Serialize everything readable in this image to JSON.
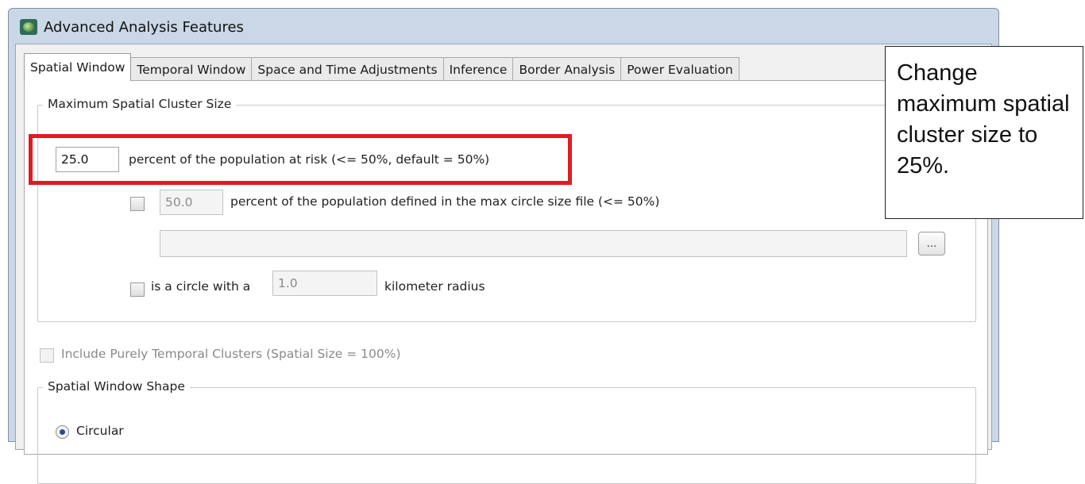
{
  "window": {
    "title": "Advanced Analysis Features"
  },
  "tabs": [
    {
      "label": "Spatial Window",
      "active": true
    },
    {
      "label": "Temporal Window",
      "active": false
    },
    {
      "label": "Space and Time Adjustments",
      "active": false
    },
    {
      "label": "Inference",
      "active": false
    },
    {
      "label": "Border Analysis",
      "active": false
    },
    {
      "label": "Power Evaluation",
      "active": false
    }
  ],
  "max_spatial_cluster": {
    "group_label": "Maximum Spatial Cluster Size",
    "population_percent_value": "25.0",
    "population_percent_label": "percent of the population at risk (<= 50%, default = 50%)",
    "max_circle_checked": false,
    "max_circle_percent_value": "50.0",
    "max_circle_label": "percent of the population defined in the max circle size file (<= 50%)",
    "max_circle_file_value": "",
    "browse_label": "...",
    "circle_radius_checked": false,
    "circle_radius_prefix": "is a circle with a",
    "circle_radius_value": "1.0",
    "circle_radius_suffix": "kilometer radius"
  },
  "purely_temporal": {
    "label": "Include Purely Temporal Clusters (Spatial Size = 100%)",
    "checked": false
  },
  "window_shape": {
    "group_label": "Spatial Window Shape",
    "options": [
      {
        "label": "Circular",
        "selected": true
      }
    ]
  },
  "callout": {
    "text": "Change maximum spatial cluster size to 25%."
  },
  "colors": {
    "highlight": "#e11b22",
    "window_frame": "#c9d7e6",
    "panel_background": "#ffffff"
  }
}
